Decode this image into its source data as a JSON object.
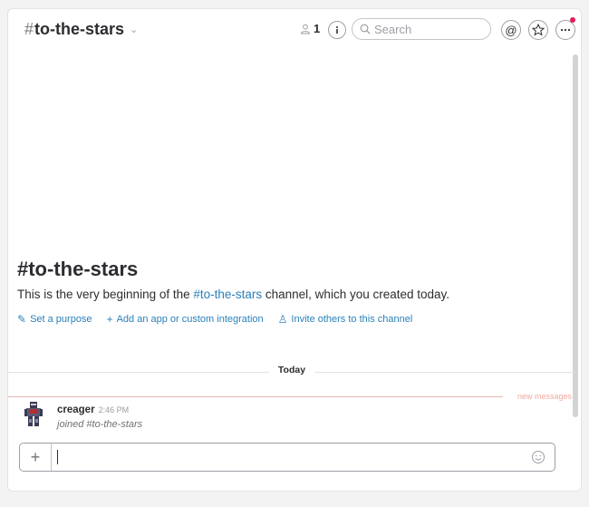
{
  "header": {
    "channel_hash": "#",
    "channel_name": "to-the-stars",
    "chevron": "⌄",
    "member_count": "1",
    "search_placeholder": "Search"
  },
  "intro": {
    "title": "#to-the-stars",
    "text_before": "This is the very beginning of the ",
    "text_link": "#to-the-stars",
    "text_after": " channel, which you created today.",
    "actions": [
      {
        "icon": "pencil-icon",
        "glyph": "✎",
        "label": "Set a purpose"
      },
      {
        "icon": "plus-icon",
        "glyph": "+",
        "label": "Add an app or custom integration"
      },
      {
        "icon": "person-icon",
        "glyph": "♙",
        "label": "Invite others to this channel"
      }
    ]
  },
  "dividers": {
    "day_label": "Today",
    "new_messages_label": "new messages"
  },
  "messages": [
    {
      "user": "creager",
      "time": "2:46 PM",
      "text": "joined #to-the-stars"
    }
  ],
  "composer": {
    "plus_glyph": "+",
    "value": "",
    "placeholder": ""
  },
  "colors": {
    "link": "#2a80b9",
    "text": "#2c2d30",
    "notification_dot": "#e01e5a",
    "new_messages": "#f2a9a0"
  }
}
